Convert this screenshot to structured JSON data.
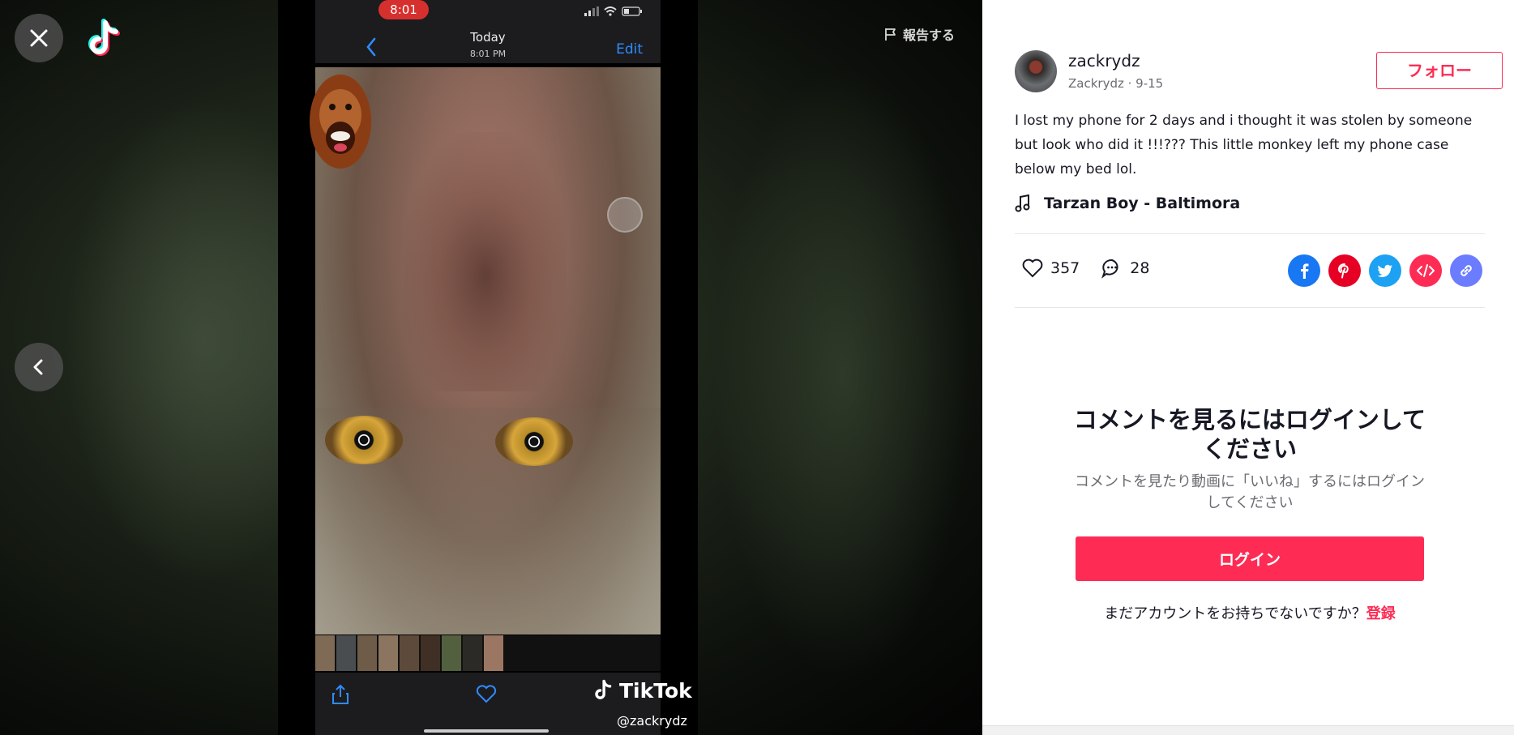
{
  "viewer": {
    "report_label": "報告する"
  },
  "video": {
    "status_time": "8:01",
    "photos_title": "Today",
    "photos_subtitle": "8:01 PM",
    "photos_edit": "Edit",
    "watermark_brand": "TikTok",
    "watermark_handle": "@zackrydz"
  },
  "author": {
    "username": "zackrydz",
    "meta": "Zackrydz · 9-15",
    "follow_label": "フォロー"
  },
  "post": {
    "caption": "I lost my phone for 2 days and i thought it was stolen by someone but look who did it !!!??? This little monkey left my phone case below my bed lol.",
    "music": "Tarzan Boy - Baltimora",
    "likes": "357",
    "comments": "28"
  },
  "share": {
    "icons": [
      "facebook-icon",
      "pinterest-icon",
      "twitter-icon",
      "embed-icon",
      "link-icon"
    ],
    "colors": {
      "facebook": "#1877f2",
      "pinterest": "#e60023",
      "twitter": "#1da1f2",
      "embed": "#fe2c55",
      "link": "#6b7cff"
    }
  },
  "login": {
    "heading": "コメントを見るにはログインしてください",
    "description": "コメントを見たり動画に「いいね」するにはログインしてください",
    "button_label": "ログイン",
    "signup_prompt": "まだアカウントをお持ちでないですか？",
    "signup_link": "登録"
  },
  "colors": {
    "accent": "#fe2c55",
    "text": "#161823",
    "muted": "#6b6c72"
  }
}
